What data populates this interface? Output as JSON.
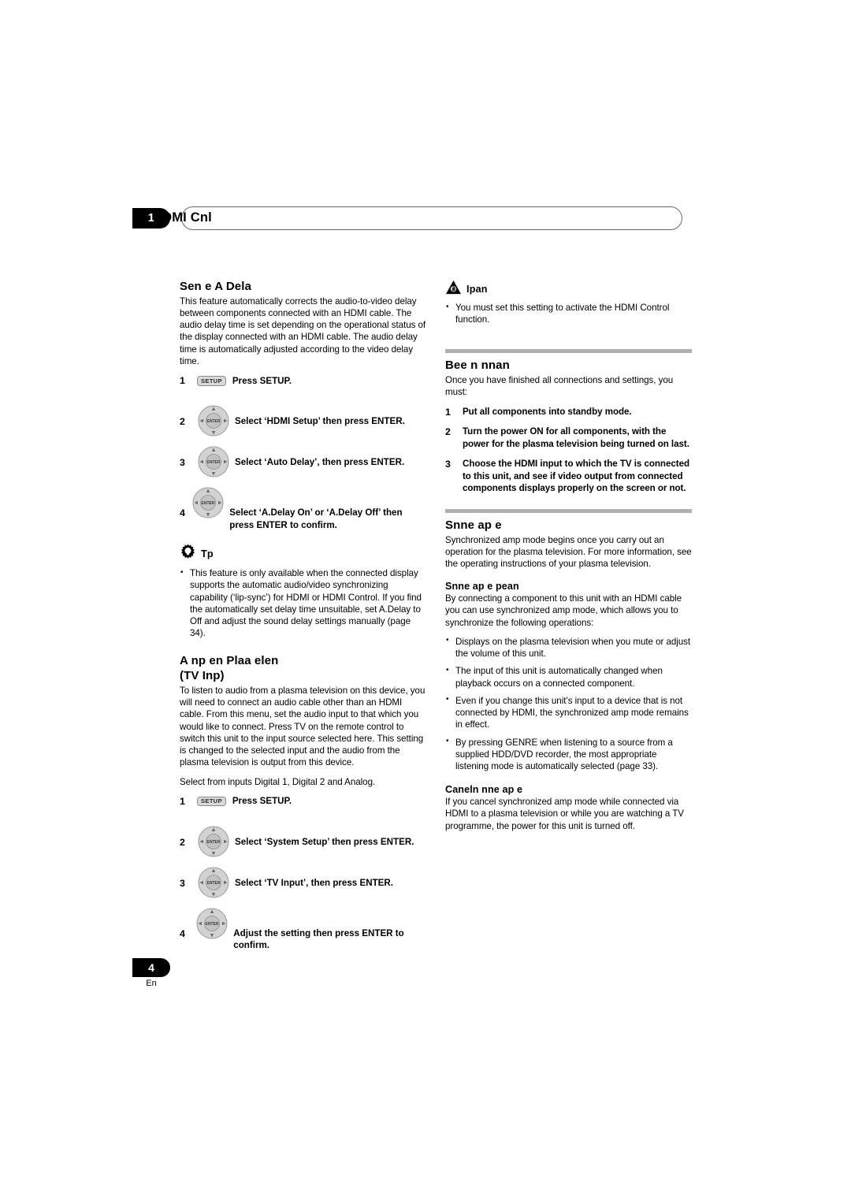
{
  "header": {
    "chapter_number": "1",
    "title": "HDMI Cnl"
  },
  "footer": {
    "page_number": "4",
    "language": "En"
  },
  "left_column": {
    "section1": {
      "heading": "Sen e A Dela",
      "body": "This feature automatically corrects the audio-to-video delay between components connected with an HDMI cable. The audio delay time is set depending on the operational status of the display connected with an HDMI cable. The audio delay time is automatically adjusted according to the video delay time.",
      "steps": [
        {
          "num": "1",
          "icon": "setup-key",
          "key_label": "SETUP",
          "text": "Press SETUP."
        },
        {
          "num": "2",
          "icon": "cursor-pad",
          "key_label": "ENTER",
          "text": "Select ‘HDMI Setup’ then press ENTER."
        },
        {
          "num": "3",
          "icon": "cursor-pad",
          "key_label": "ENTER",
          "text": "Select ‘Auto Delay’, then press ENTER."
        },
        {
          "num": "4",
          "icon": "cursor-pad",
          "key_label": "ENTER",
          "text": "Select ‘A.Delay On’ or ‘A.Delay Off’ then press ENTER to confirm."
        }
      ]
    },
    "tip": {
      "icon": "lightbulb-icon",
      "title": "Tp",
      "bullets": [
        "This feature is only available when the connected display supports the automatic audio/video synchronizing capability (‘lip-sync’) for HDMI or HDMI Control. If you find the automatically set delay time unsuitable, set A.Delay to Off and adjust the sound delay settings manually (page 34)."
      ]
    },
    "section2": {
      "heading": "A np en Plaa elen",
      "subheading": "(TV Inp)",
      "body": "To listen to audio from a plasma television on this device, you will need to connect an audio cable other than an HDMI cable. From this menu, set the audio input to that which you would like to connect. Press TV on the remote control to switch this unit to the input source selected here. This setting is changed to the selected input and the audio from the plasma television is output from this device.",
      "body2": "Select from inputs Digital 1, Digital 2 and Analog.",
      "steps": [
        {
          "num": "1",
          "icon": "setup-key",
          "key_label": "SETUP",
          "text": "Press SETUP."
        },
        {
          "num": "2",
          "icon": "cursor-pad",
          "key_label": "ENTER",
          "text": "Select ‘System Setup’ then press ENTER."
        },
        {
          "num": "3",
          "icon": "cursor-pad",
          "key_label": "ENTER",
          "text": "Select ‘TV Input’, then press ENTER."
        },
        {
          "num": "4",
          "icon": "cursor-pad",
          "key_label": "ENTER",
          "text": "Adjust the setting then press ENTER to confirm."
        }
      ]
    }
  },
  "right_column": {
    "important": {
      "icon": "warning-triangle-icon",
      "title": "Ipan",
      "bullets": [
        "You must set this setting to activate the HDMI Control function."
      ]
    },
    "section1": {
      "heading": "Bee n nnan",
      "body": "Once you have finished all connections and settings, you must:",
      "items": [
        {
          "num": "1",
          "text": "Put all components into standby mode."
        },
        {
          "num": "2",
          "text": "Turn the power ON for all components, with the power for the plasma television being turned on last."
        },
        {
          "num": "3",
          "text": "Choose the HDMI input to which the TV is connected to this unit, and see if video output from connected components displays properly on the screen or not."
        }
      ]
    },
    "section2": {
      "heading": "Snne ap e",
      "body": "Synchronized amp mode begins once you carry out an operation for the plasma television. For more information, see the operating instructions of your plasma television.",
      "subsection": {
        "heading": "Snne ap e pean",
        "body": "By connecting a component to this unit with an HDMI cable you can use synchronized amp mode, which allows you to synchronize the following operations:",
        "bullets": [
          "Displays on the plasma television when you mute or adjust the volume of this unit.",
          "The input of this unit is automatically changed when playback occurs on a connected component.",
          "Even if you change this unit’s input to a device that is not connected by HDMI, the synchronized amp mode remains in effect.",
          "By pressing GENRE when listening to a source from a supplied HDD/DVD recorder, the most appropriate listening mode is automatically selected (page 33)."
        ]
      }
    },
    "section3": {
      "heading": "Caneln nne ap e",
      "body": "If you cancel synchronized amp mode while connected via HDMI to a plasma television or while you are watching a TV programme, the power for this unit is turned off."
    }
  },
  "colors": {
    "rule": "#b0b0b0",
    "tab_background": "#000000",
    "key_background": "#d9d9d9"
  }
}
